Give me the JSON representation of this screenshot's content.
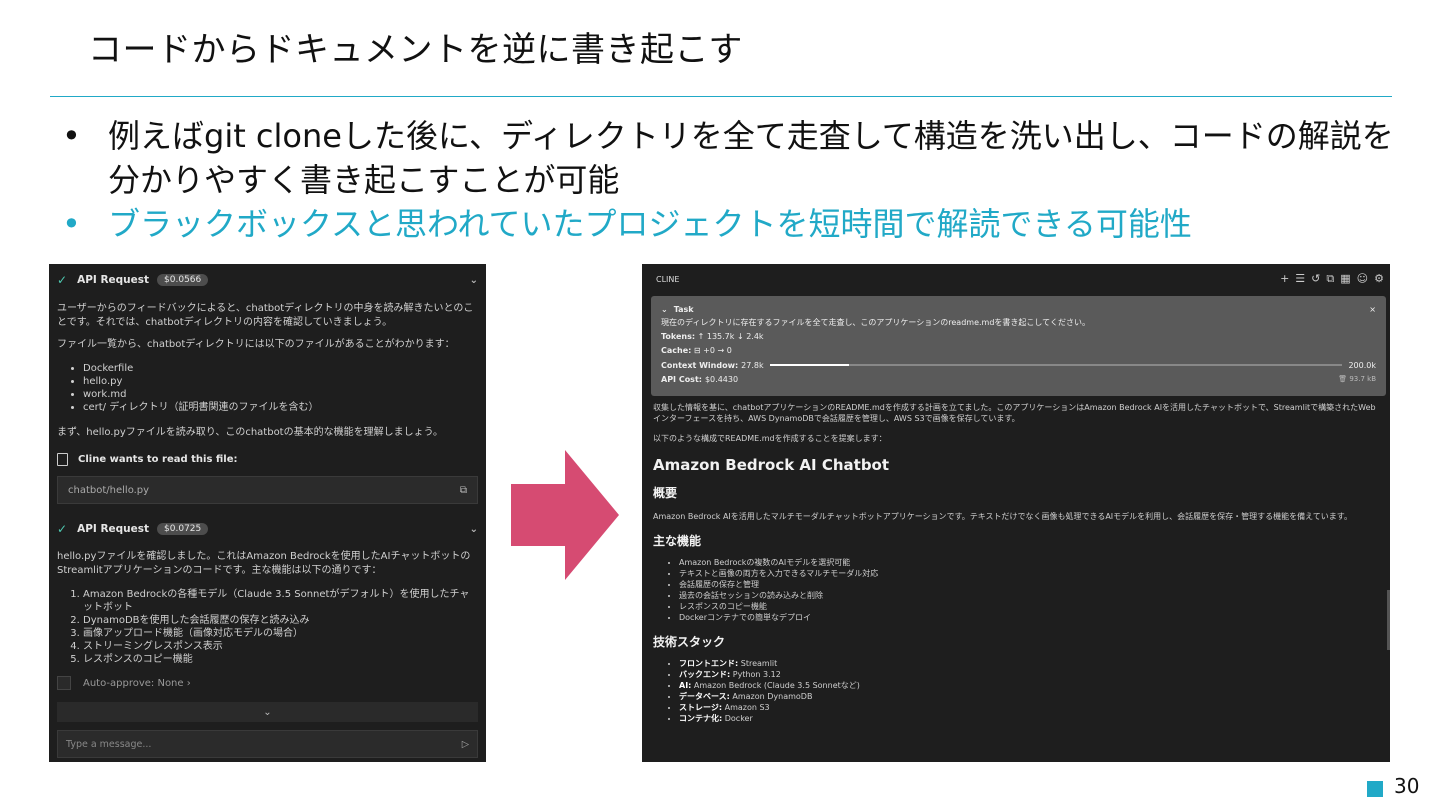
{
  "slide": {
    "title": "コードからドキュメントを逆に書き起こす",
    "bullets": [
      "例えばgit cloneした後に、ディレクトリを全て走査して構造を洗い出し、コードの解説を分かりやすく書き起こすことが可能",
      "ブラックボックスと思われていたプロジェクトを短時間で解読できる可能性"
    ],
    "bullet_marker": "•",
    "page_number": "30",
    "accent_color": "#21a9c7",
    "arrow_color": "#d64b72"
  },
  "left_panel": {
    "api_request_1": {
      "label": "API Request",
      "cost": "$0.0566"
    },
    "para_1": "ユーザーからのフィードバックによると、chatbotディレクトリの中身を読み解きたいとのことです。それでは、chatbotディレクトリの内容を確認していきましょう。",
    "para_2": "ファイル一覧から、chatbotディレクトリには以下のファイルがあることがわかります：",
    "files": [
      "Dockerfile",
      "hello.py",
      "work.md",
      "cert/ ディレクトリ（証明書関連のファイルを含む）"
    ],
    "para_3": "まず、hello.pyファイルを読み取り、このchatbotの基本的な機能を理解しましょう。",
    "read_file_label": "Cline wants to read this file:",
    "file_path": "chatbot/hello.py",
    "api_request_2": {
      "label": "API Request",
      "cost": "$0.0725"
    },
    "para_4": "hello.pyファイルを確認しました。これはAmazon Bedrockを使用したAIチャットボットのStreamlitアプリケーションのコードです。主な機能は以下の通りです：",
    "features": [
      "Amazon Bedrockの各種モデル（Claude 3.5 Sonnetがデフォルト）を使用したチャットボット",
      "DynamoDBを使用した会話履歴の保存と読み込み",
      "画像アップロード機能（画像対応モデルの場合）",
      "ストリーミングレスポンス表示",
      "レスポンスのコピー機能"
    ],
    "auto_approve": "Auto-approve: None ›",
    "message_placeholder": "Type a message..."
  },
  "right_panel": {
    "header": "CLINE",
    "toolbar_icons": [
      "plus-icon",
      "server-icon",
      "history-icon",
      "external-link-icon",
      "grid-icon",
      "account-icon",
      "gear-icon"
    ],
    "task": {
      "label": "Task",
      "description": "現在のディレクトリに存在するファイルを全て走査し、このアプリケーションのreadme.mdを書き起こしてください。",
      "tokens_label": "Tokens:",
      "tokens_value": "↑ 135.7k ↓ 2.4k",
      "cache_label": "Cache:",
      "cache_value": "⊟ +0 → 0",
      "context_label": "Context Window:",
      "context_used": "27.8k",
      "context_max": "200.0k",
      "context_fraction": 0.139,
      "cost_label": "API Cost:",
      "cost_value": "$0.4430",
      "storage": "93.7 kB"
    },
    "para_1": "収集した情報を基に、chatbotアプリケーションのREADME.mdを作成する計画を立てました。このアプリケーションはAmazon Bedrock AIを活用したチャットボットで、Streamlitで構築されたWebインターフェースを持ち、AWS DynamoDBで会話履歴を管理し、AWS S3で画像を保存しています。",
    "para_2": "以下のような構成でREADME.mdを作成することを提案します：",
    "h1": "Amazon Bedrock AI Chatbot",
    "overview_heading": "概要",
    "overview_text": "Amazon Bedrock AIを活用したマルチモーダルチャットボットアプリケーションです。テキストだけでなく画像も処理できるAIモデルを利用し、会話履歴を保存・管理する機能を備えています。",
    "features_heading": "主な機能",
    "features": [
      "Amazon Bedrockの複数のAIモデルを選択可能",
      "テキストと画像の両方を入力できるマルチモーダル対応",
      "会話履歴の保存と管理",
      "過去の会話セッションの読み込みと削除",
      "レスポンスのコピー機能",
      "Dockerコンテナでの簡単なデプロイ"
    ],
    "stack_heading": "技術スタック",
    "stack": [
      {
        "key": "フロントエンド:",
        "value": " Streamlit"
      },
      {
        "key": "バックエンド:",
        "value": " Python 3.12"
      },
      {
        "key": "AI:",
        "value": " Amazon Bedrock (Claude 3.5 Sonnetなど)"
      },
      {
        "key": "データベース:",
        "value": " Amazon DynamoDB"
      },
      {
        "key": "ストレージ:",
        "value": " Amazon S3"
      },
      {
        "key": "コンテナ化:",
        "value": " Docker"
      }
    ]
  }
}
